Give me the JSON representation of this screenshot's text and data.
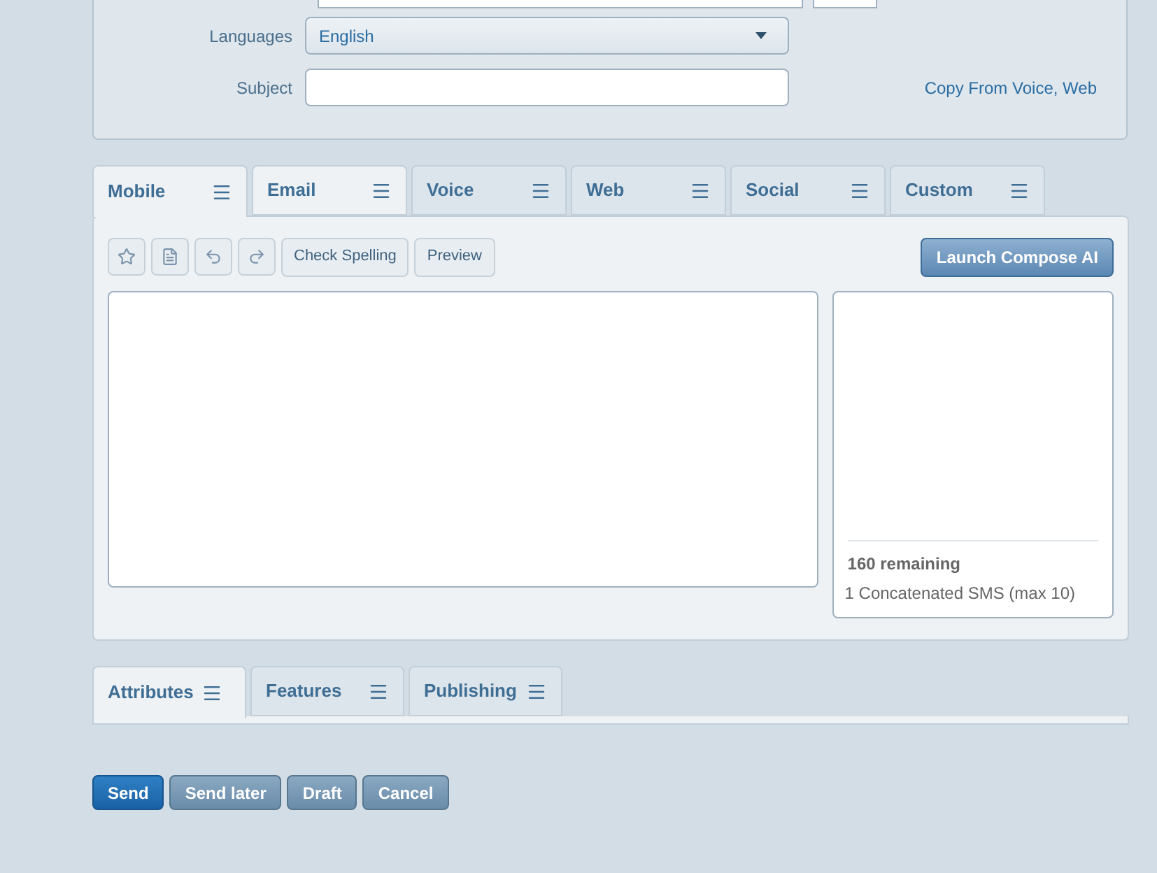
{
  "form": {
    "fields": [
      {
        "label": "Languages",
        "kind": "select",
        "value": "English"
      },
      {
        "label": "Subject",
        "kind": "text"
      }
    ],
    "copy_link": "Copy From Voice, Web"
  },
  "channel_tabs": [
    {
      "label": "Mobile",
      "selected": true,
      "highlighted": true
    },
    {
      "label": "Email",
      "selected": false,
      "highlighted": true
    },
    {
      "label": "Voice",
      "selected": false,
      "highlighted": false
    },
    {
      "label": "Web",
      "selected": false,
      "highlighted": false
    },
    {
      "label": "Social",
      "selected": false,
      "highlighted": false
    },
    {
      "label": "Custom",
      "selected": false,
      "highlighted": false
    }
  ],
  "toolbar": {
    "buttons": [
      "Check Spelling",
      "Preview"
    ],
    "compose_button": "Launch Compose AI"
  },
  "counter": {
    "remaining": "160 remaining",
    "sms": "1 Concatenated SMS (max 10)"
  },
  "bottom_tabs": [
    {
      "label": "Attributes",
      "selected": true
    },
    {
      "label": "Features",
      "selected": false
    },
    {
      "label": "Publishing",
      "selected": false
    }
  ],
  "actions": [
    {
      "label": "Send",
      "primary": true
    },
    {
      "label": "Send later",
      "primary": false
    },
    {
      "label": "Draft",
      "primary": false
    },
    {
      "label": "Cancel",
      "primary": false
    }
  ]
}
